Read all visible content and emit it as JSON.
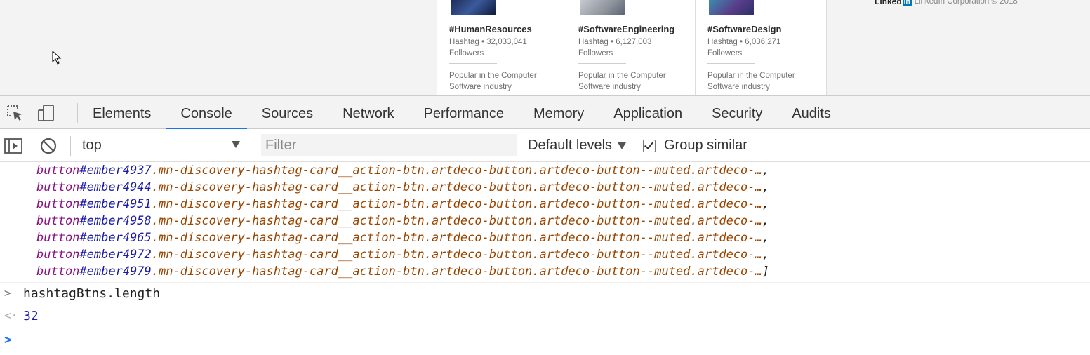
{
  "page": {
    "cards": [
      {
        "title": "#HumanResources",
        "meta": "Hashtag • 32,033,041 Followers",
        "popular": "Popular in the Computer Software industry"
      },
      {
        "title": "#SoftwareEngineering",
        "meta": "Hashtag • 6,127,003 Followers",
        "popular": "Popular in the Computer Software industry"
      },
      {
        "title": "#SoftwareDesign",
        "meta": "Hashtag • 6,036,271 Followers",
        "popular": "Popular in the Computer Software industry"
      }
    ],
    "footer": {
      "logo_text": "Linked",
      "logo_in": "in",
      "copyright": "LinkedIn Corporation © 2018"
    }
  },
  "devtools": {
    "tabs": [
      "Elements",
      "Console",
      "Sources",
      "Network",
      "Performance",
      "Memory",
      "Application",
      "Security",
      "Audits"
    ],
    "active_tab": "Console",
    "icons": {
      "inspect": "inspect-element-icon",
      "device": "device-toolbar-icon",
      "sidebar": "console-sidebar-icon",
      "clear": "clear-console-icon"
    },
    "accent_color": "#1a73e8"
  },
  "console_toolbar": {
    "context": "top",
    "filter_placeholder": "Filter",
    "levels": "Default levels",
    "group_similar": "Group similar",
    "group_similar_checked": true
  },
  "console": {
    "array_lines": [
      {
        "tag": "button",
        "id": "#ember4937",
        "cls": ".mn-discovery-hashtag-card__action-btn.artdeco-button.artdeco-button--muted.artdeco-…",
        "end": ","
      },
      {
        "tag": "button",
        "id": "#ember4944",
        "cls": ".mn-discovery-hashtag-card__action-btn.artdeco-button.artdeco-button--muted.artdeco-…",
        "end": ","
      },
      {
        "tag": "button",
        "id": "#ember4951",
        "cls": ".mn-discovery-hashtag-card__action-btn.artdeco-button.artdeco-button--muted.artdeco-…",
        "end": ","
      },
      {
        "tag": "button",
        "id": "#ember4958",
        "cls": ".mn-discovery-hashtag-card__action-btn.artdeco-button.artdeco-button--muted.artdeco-…",
        "end": ","
      },
      {
        "tag": "button",
        "id": "#ember4965",
        "cls": ".mn-discovery-hashtag-card__action-btn.artdeco-button.artdeco-button--muted.artdeco-…",
        "end": ","
      },
      {
        "tag": "button",
        "id": "#ember4972",
        "cls": ".mn-discovery-hashtag-card__action-btn.artdeco-button.artdeco-button--muted.artdeco-…",
        "end": ","
      },
      {
        "tag": "button",
        "id": "#ember4979",
        "cls": ".mn-discovery-hashtag-card__action-btn.artdeco-button.artdeco-button--muted.artdeco-…",
        "end": "]"
      }
    ],
    "command": "hashtagBtns.length",
    "command_marker": ">",
    "result": "32",
    "result_marker": "<·",
    "prompt_marker": ">"
  }
}
